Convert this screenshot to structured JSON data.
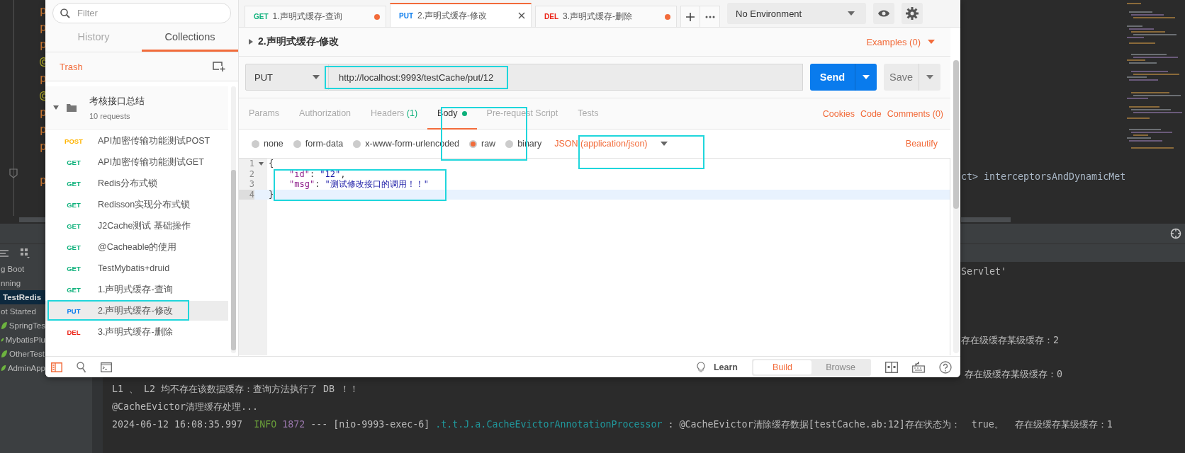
{
  "ide": {
    "code_fragments": [
      {
        "kind": "key",
        "text": "p"
      },
      {
        "kind": "key",
        "text": "p"
      },
      {
        "kind": "key",
        "text": "p"
      },
      {
        "kind": "annotation",
        "text": "@"
      },
      {
        "kind": "key",
        "text": "p"
      },
      {
        "kind": "annotation",
        "text": "@"
      },
      {
        "kind": "key",
        "text": "p"
      },
      {
        "kind": "key",
        "text": "p"
      },
      {
        "kind": "key",
        "text": "p"
      },
      {
        "kind": "blank"
      },
      {
        "kind": "key",
        "text": "p"
      }
    ],
    "editor_fragment": "ct> interceptorsAndDynamicMet",
    "run_tree": [
      {
        "label": "g Boot",
        "kind": "group",
        "selected": false
      },
      {
        "label": "nning",
        "kind": "group",
        "selected": false
      },
      {
        "label": "TestRedis",
        "kind": "group",
        "selected": true
      },
      {
        "label": "ot Started",
        "kind": "group",
        "selected": false
      },
      {
        "label": "SpringTes",
        "kind": "app",
        "selected": false
      },
      {
        "label": "MybatisPlu",
        "kind": "app",
        "selected": false
      },
      {
        "label": "OtherTest",
        "kind": "app",
        "selected": false
      },
      {
        "label": "AdminApp",
        "kind": "app",
        "selected": false
      }
    ],
    "log_fragments": [
      "Servlet'",
      "存在级缓存某级缓存：2",
      "存在级缓存某级缓存：0"
    ],
    "console": [
      [
        {
          "kind": "plain",
          "text": "L1 、 L2 均不存在该数据缓存：查询方法执行了 DB ！！"
        }
      ],
      [
        {
          "kind": "plain",
          "text": "@CacheEvictor清理缓存处理..."
        }
      ],
      [
        {
          "kind": "plain",
          "text": "2024-06-12 16:08:35.997  "
        },
        {
          "kind": "level",
          "text": "INFO"
        },
        {
          "kind": "pid",
          "text": " 1872"
        },
        {
          "kind": "plain",
          "text": " --- [nio-9993-exec-6] "
        },
        {
          "kind": "logger",
          "text": ".t.t.J.a.CacheEvictorAnnotationProcessor"
        },
        {
          "kind": "plain",
          "text": " : @CacheEvictor清除缓存数据[testCache.ab:12]存在状态为：  true。  存在级缓存某级缓存：1"
        }
      ]
    ]
  },
  "postman": {
    "sidebar": {
      "filter_placeholder": "Filter",
      "tabs": [
        {
          "label": "History",
          "selected": false
        },
        {
          "label": "Collections",
          "selected": true
        }
      ],
      "trash": "Trash",
      "collection": {
        "name": "考核接口总结",
        "count": "10 requests",
        "expanded": true,
        "requests": [
          {
            "method": "POST",
            "color": "#ffb400",
            "name": "API加密传输功能测试POST",
            "selected": false
          },
          {
            "method": "GET",
            "color": "#0cb07a",
            "name": "API加密传输功能测试GET",
            "selected": false
          },
          {
            "method": "GET",
            "color": "#0cb07a",
            "name": "Redis分布式锁",
            "selected": false
          },
          {
            "method": "GET",
            "color": "#0cb07a",
            "name": "Redisson实现分布式锁",
            "selected": false
          },
          {
            "method": "GET",
            "color": "#0cb07a",
            "name": "J2Cache测试 基础操作",
            "selected": false
          },
          {
            "method": "GET",
            "color": "#0cb07a",
            "name": "@Cacheable的使用",
            "selected": false
          },
          {
            "method": "GET",
            "color": "#0cb07a",
            "name": "TestMybatis+druid",
            "selected": false
          },
          {
            "method": "GET",
            "color": "#0cb07a",
            "name": "1.声明式缓存-查询",
            "selected": false
          },
          {
            "method": "PUT",
            "color": "#097bed",
            "name": "2.声明式缓存-修改",
            "selected": true
          },
          {
            "method": "DEL",
            "color": "#eb2013",
            "name": "3.声明式缓存-删除",
            "selected": false
          }
        ]
      }
    },
    "tabs": [
      {
        "method": "GET",
        "color": "#0cb07a",
        "title": "1.声明式缓存-查询",
        "selected": false,
        "unsaved": true
      },
      {
        "method": "PUT",
        "color": "#097bed",
        "title": "2.声明式缓存-修改",
        "selected": true,
        "unsaved": false
      },
      {
        "method": "DEL",
        "color": "#eb2013",
        "title": "3.声明式缓存-删除",
        "selected": false,
        "unsaved": true
      }
    ],
    "environment": "No Environment",
    "request": {
      "title": "2.声明式缓存-修改",
      "examples": "Examples (0)",
      "method": "PUT",
      "url": "http://localhost:9993/testCache/put/12",
      "send": "Send",
      "save": "Save",
      "tabs": [
        {
          "label": "Params",
          "selected": false
        },
        {
          "label": "Authorization",
          "selected": false
        },
        {
          "label": "Headers",
          "count": "(1)",
          "selected": false
        },
        {
          "label": "Body",
          "selected": true,
          "dot": true
        },
        {
          "label": "Pre-request Script",
          "selected": false
        },
        {
          "label": "Tests",
          "selected": false
        }
      ],
      "links": [
        "Cookies",
        "Code",
        "Comments (0)"
      ],
      "body_types": [
        {
          "label": "none",
          "selected": false
        },
        {
          "label": "form-data",
          "selected": false
        },
        {
          "label": "x-www-form-urlencoded",
          "selected": false
        },
        {
          "label": "raw",
          "selected": true
        },
        {
          "label": "binary",
          "selected": false
        }
      ],
      "content_type": "JSON (application/json)",
      "beautify": "Beautify",
      "code_lines": [
        {
          "number": "1",
          "foldable": true,
          "active": false,
          "indented": false,
          "tokens": [
            {
              "kind": "punct",
              "text": "{"
            }
          ]
        },
        {
          "number": "2",
          "foldable": false,
          "active": false,
          "indented": true,
          "tokens": [
            {
              "kind": "key",
              "text": "\"id\""
            },
            {
              "kind": "punct",
              "text": ": "
            },
            {
              "kind": "string",
              "text": "\"12\""
            },
            {
              "kind": "punct",
              "text": ","
            }
          ]
        },
        {
          "number": "3",
          "foldable": false,
          "active": false,
          "indented": true,
          "tokens": [
            {
              "kind": "key",
              "text": "\"msg\""
            },
            {
              "kind": "punct",
              "text": ": "
            },
            {
              "kind": "string",
              "text": "\"测试修改接口的调用！！\""
            }
          ]
        },
        {
          "number": "4",
          "foldable": false,
          "active": true,
          "indented": false,
          "tokens": [
            {
              "kind": "punct",
              "text": "}"
            }
          ]
        }
      ]
    },
    "bottom_bar": {
      "learn": "Learn",
      "modes": [
        {
          "label": "Build",
          "selected": true
        },
        {
          "label": "Browse",
          "selected": false
        }
      ]
    }
  }
}
